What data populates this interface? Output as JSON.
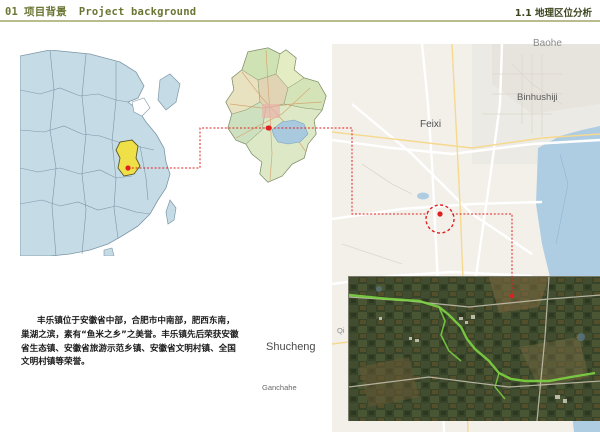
{
  "header": {
    "section_number": "01",
    "section_title_cn": "项目背景",
    "section_title_en": "Project background",
    "subsection": "1.1 地理区位分析"
  },
  "maps": {
    "region_labels": {
      "baohe": "Baohe",
      "binhushiji": "Binhushiji",
      "feixi": "Feixi",
      "shucheng": "Shucheng",
      "ganchahe": "Ganchahe",
      "qi": "Qi"
    }
  },
  "description": "丰乐镇位于安徽省中部，合肥市中南部，肥西东南，巢湖之滨，素有“鱼米之乡”之美誉。丰乐镇先后荣获安徽省生态镇、安徽省旅游示范乡镇、安徽省文明村镇、全国文明村镇等荣誉。",
  "colors": {
    "header_green": "#6b7533",
    "marker_red": "#e02020",
    "highlight_yellow": "#f0e048",
    "china_fill": "#c5dbe6",
    "water_blue": "#a9c9df",
    "route_green": "#7cd444"
  }
}
